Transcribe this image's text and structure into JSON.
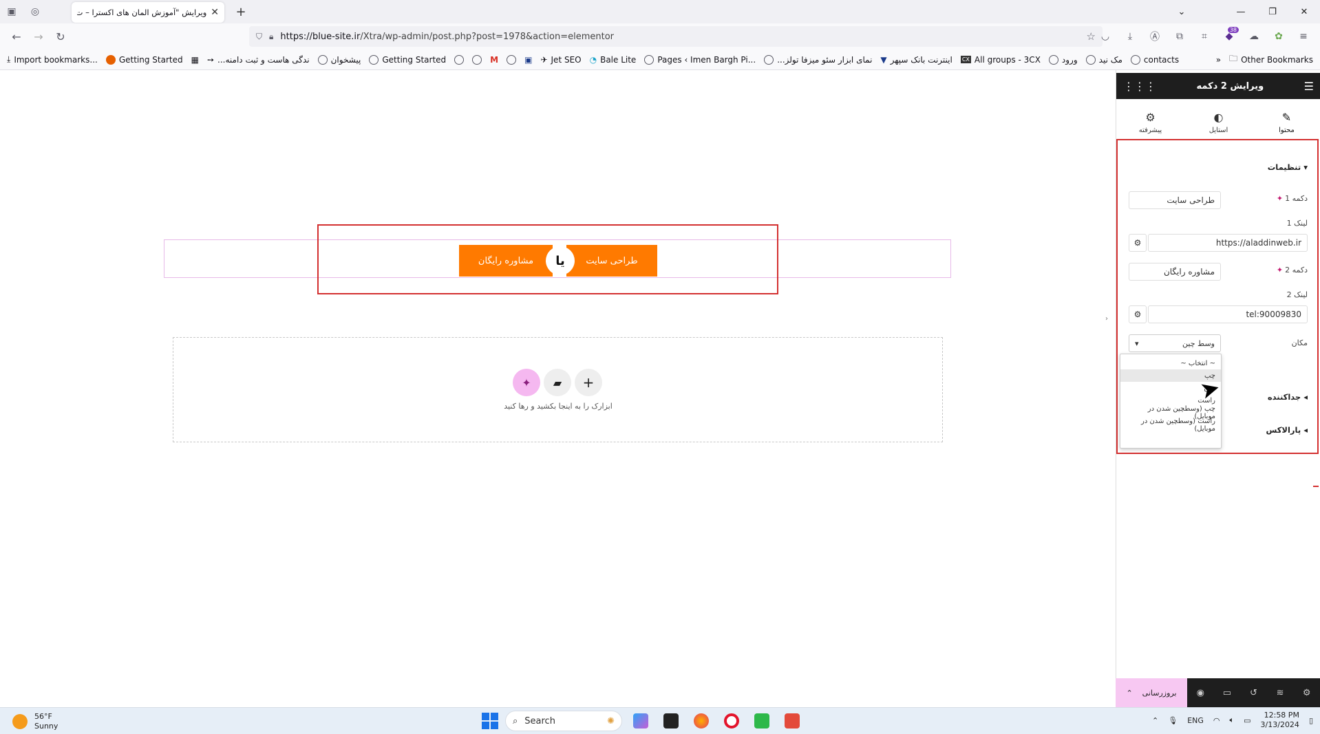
{
  "browser": {
    "tab_title": "ویرایش \"آموزش المان های اکسترا – ت",
    "url_domain": "https://blue-site.ir",
    "url_path": "/Xtra/wp-admin/post.php?post=1978&action=elementor",
    "extension_badge": "38",
    "bookmarks": [
      "Import bookmarks...",
      "Getting Started",
      "...ندگی هاست و ثبت دامنه",
      "پیشخوان",
      "Getting Started",
      "Jet SEO",
      "Bale Lite",
      "Pages ‹ Imen Bargh Pi...",
      "...نمای ابزار سئو میزفا تولز",
      "اینترنت بانک سپهر",
      "All groups - 3CX",
      "ورود",
      "مک نید",
      "contacts"
    ],
    "other_bookmarks": "Other Bookmarks"
  },
  "canvas": {
    "button1_label": "طراحی سایت",
    "button2_label": "مشاوره رایگان",
    "divider_text": "یا",
    "dropzone_text": "ابزارک را به اینجا بکشید و رها کنید"
  },
  "panel": {
    "title": "ویرایش 2 دکمه",
    "tabs": [
      {
        "label": "محتوا",
        "icon": "pencil-icon"
      },
      {
        "label": "استایل",
        "icon": "contrast-icon"
      },
      {
        "label": "پیشرفته",
        "icon": "gear-icon"
      }
    ],
    "settings_title": "تنظیمات",
    "button1_label": "دکمه 1",
    "button1_value": "طراحی سایت",
    "link1_label": "لینک 1",
    "link1_value": "https://aladdinweb.ir",
    "button2_label": "دکمه 2",
    "button2_value": "مشاوره رایگان",
    "link2_label": "لینک 2",
    "link2_value": "tel:90009830",
    "position_label": "مکان",
    "position_value": "وسط چین",
    "dropdown_options": [
      "~ انتخاب ~",
      "چپ",
      "چین",
      "راست",
      "چپ (وسطچین شدن در موبایل)",
      "راست (وسطچین شدن در موبایل)"
    ],
    "separator_title": "جداکننده",
    "parallax_title": "پارالاکس",
    "update_label": "بروزرسانی"
  },
  "taskbar": {
    "temperature": "56°F",
    "condition": "Sunny",
    "search_placeholder": "Search",
    "language": "ENG",
    "time": "12:58 PM",
    "date": "3/13/2024"
  },
  "colors": {
    "accent_orange": "#ff7a00",
    "selection_red": "#d32f2f",
    "ai_pink": "#f5b8f0"
  }
}
